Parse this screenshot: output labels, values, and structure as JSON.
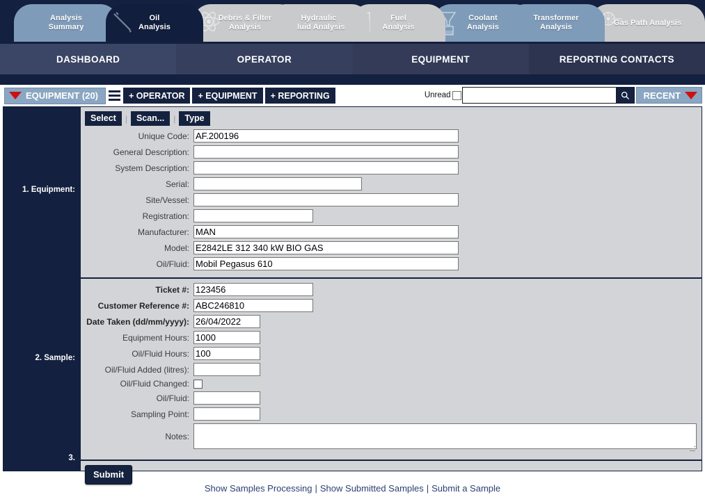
{
  "tabs": [
    {
      "line1": "Analysis",
      "line2": "Summary",
      "style": "steel",
      "icon": "none",
      "active": false
    },
    {
      "line1": "Oil",
      "line2": "Analysis",
      "style": "dark",
      "icon": "dipstick-icon",
      "active": true
    },
    {
      "line1": "Debris & Filter",
      "line2": "Analysis",
      "style": "grey",
      "icon": "atom-icon",
      "active": false
    },
    {
      "line1": "Hydraulic",
      "line2": "Fluid Analysis",
      "style": "grey",
      "icon": "test-tube-icon",
      "active": false
    },
    {
      "line1": "Fuel",
      "line2": "Analysis",
      "style": "grey",
      "icon": "fuel-pump-icon",
      "active": false
    },
    {
      "line1": "Coolant",
      "line2": "Analysis",
      "style": "steel",
      "icon": "funnel-icon",
      "active": false
    },
    {
      "line1": "Transformer",
      "line2": "Analysis",
      "style": "steel",
      "icon": "coil-icon",
      "active": false
    },
    {
      "line1": "Gas Path Analysis",
      "line2": "",
      "style": "grey",
      "icon": "turbine-icon",
      "active": false
    }
  ],
  "mainnav": [
    {
      "label": "DASHBOARD"
    },
    {
      "label": "OPERATOR"
    },
    {
      "label": "EQUIPMENT"
    },
    {
      "label": "REPORTING CONTACTS"
    }
  ],
  "toolbar": {
    "equipment_dropdown": "EQUIPMENT (20)",
    "menu_icon": "hamburger-icon",
    "add_operator": "+ OPERATOR",
    "add_equipment": "+ EQUIPMENT",
    "add_reporting": "+ REPORTING",
    "unread_label": "Unread",
    "unread_checked": false,
    "search_value": "",
    "search_placeholder": "",
    "search_icon": "magnifier-icon",
    "recent_label": "RECENT"
  },
  "sidebar": {
    "step1": "1. Equipment:",
    "step2": "2. Sample:",
    "step3": "3."
  },
  "equipment_section": {
    "buttons": {
      "select": "Select",
      "scan": "Scan...",
      "type": "Type",
      "separator": "|"
    },
    "fields": [
      {
        "label": "Unique Code:",
        "value": "AF.200196",
        "width": "w-full"
      },
      {
        "label": "General Description:",
        "value": "",
        "width": "w-full"
      },
      {
        "label": "System Description:",
        "value": "",
        "width": "w-full"
      },
      {
        "label": "Serial:",
        "value": "",
        "width": "w-mid"
      },
      {
        "label": "Site/Vessel:",
        "value": "",
        "width": "w-full"
      },
      {
        "label": "Registration:",
        "value": "",
        "width": "w-short"
      },
      {
        "label": "Manufacturer:",
        "value": "MAN",
        "width": "w-full"
      },
      {
        "label": "Model:",
        "value": "E2842LE 312 340 kW BIO GAS",
        "width": "w-full"
      },
      {
        "label": "Oil/Fluid:",
        "value": "Mobil Pegasus 610",
        "width": "w-full"
      }
    ]
  },
  "sample_section": {
    "fields": [
      {
        "label": "Ticket #:",
        "value": "123456",
        "width": "w-short",
        "type": "text",
        "bold": true
      },
      {
        "label": "Customer Reference #:",
        "value": "ABC246810",
        "width": "w-short",
        "type": "text",
        "bold": true
      },
      {
        "label": "Date Taken (dd/mm/yyyy):",
        "value": "26/04/2022",
        "width": "w-sm",
        "type": "text",
        "bold": true
      },
      {
        "label": "Equipment Hours:",
        "value": "1000",
        "width": "w-sm",
        "type": "text",
        "bold": false
      },
      {
        "label": "Oil/Fluid Hours:",
        "value": "100",
        "width": "w-sm",
        "type": "text",
        "bold": false
      },
      {
        "label": "Oil/Fluid Added (litres):",
        "value": "",
        "width": "w-sm",
        "type": "text",
        "bold": false
      },
      {
        "label": "Oil/Fluid Changed:",
        "value": "",
        "width": "",
        "type": "checkbox",
        "checked": false,
        "bold": false
      },
      {
        "label": "Oil/Fluid:",
        "value": "",
        "width": "w-sm",
        "type": "text",
        "bold": false
      },
      {
        "label": "Sampling Point:",
        "value": "",
        "width": "w-sm",
        "type": "text",
        "bold": false
      }
    ],
    "notes_label": "Notes:",
    "notes_value": ""
  },
  "submit": {
    "label": "Submit"
  },
  "footer": {
    "links": [
      {
        "label": "Show Samples Processing"
      },
      {
        "label": "Show Submitted Samples"
      },
      {
        "label": "Submit a Sample"
      }
    ],
    "separator": "|"
  },
  "colors": {
    "navy": "#13203f",
    "steel": "#7e9cba",
    "grey_tab": "#c9cacb",
    "panel": "#d2d4d7",
    "red": "#cc1111",
    "link": "#2b3f72"
  }
}
